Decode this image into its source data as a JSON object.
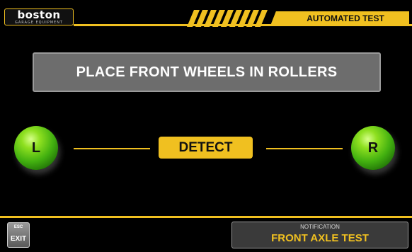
{
  "header": {
    "logo": "boston",
    "logo_subtitle": "GARAGE EQUIPMENT",
    "title": "AUTOMATED TEST"
  },
  "main": {
    "instruction": "PLACE FRONT WHEELS IN ROLLERS",
    "left_wheel_label": "L",
    "right_wheel_label": "R",
    "detect_label": "DETECT"
  },
  "footer": {
    "esc_label": "ESC",
    "exit_label": "EXIT",
    "notification_label": "NOTIFICATION",
    "notification_text": "FRONT AXLE TEST"
  },
  "colors": {
    "accent": "#f0c020",
    "background": "#000000",
    "panel": "#6d6d6d",
    "wheel": "#42b010"
  }
}
